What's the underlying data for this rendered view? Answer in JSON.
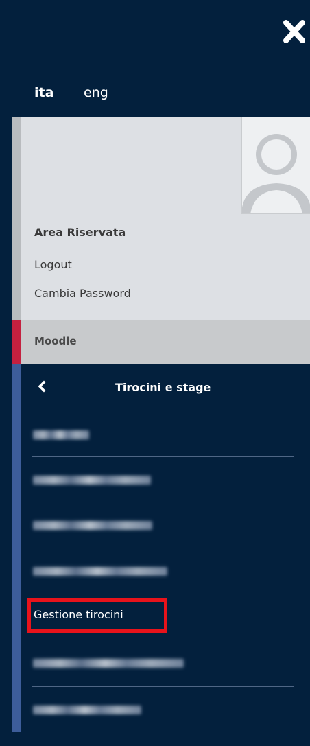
{
  "languages": [
    "ita",
    "eng"
  ],
  "active_language": "ita",
  "user_area": {
    "heading": "Area Riservata",
    "logout": "Logout",
    "change_password": "Cambia Password"
  },
  "moodle": {
    "label": "Moodle"
  },
  "submenu": {
    "title": "Tirocini e stage",
    "highlighted_item": "Gestione tirocini"
  },
  "colors": {
    "background": "#03203d",
    "user_area": "#dde0e4",
    "moodle_accent": "#c4203f",
    "submenu_accent": "#3d5d9a",
    "highlight": "#e8131b"
  }
}
